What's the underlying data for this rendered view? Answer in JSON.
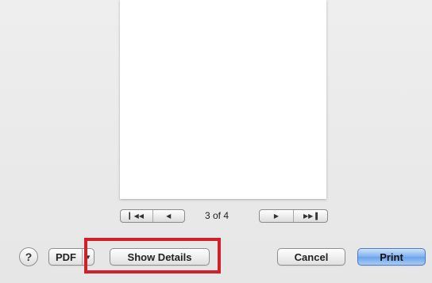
{
  "pager": {
    "first_icon": "skip-to-first-icon",
    "prev_icon": "previous-page-icon",
    "next_icon": "next-page-icon",
    "last_icon": "skip-to-last-icon",
    "page_indicator": "3 of 4"
  },
  "footer": {
    "help_label": "?",
    "pdf_label": "PDF",
    "pdf_arrow_icon": "dropdown-arrow-icon",
    "show_details_label": "Show Details",
    "cancel_label": "Cancel",
    "print_label": "Print"
  },
  "colors": {
    "highlight": "#d12027",
    "primary_button": "#6aa3ea"
  }
}
